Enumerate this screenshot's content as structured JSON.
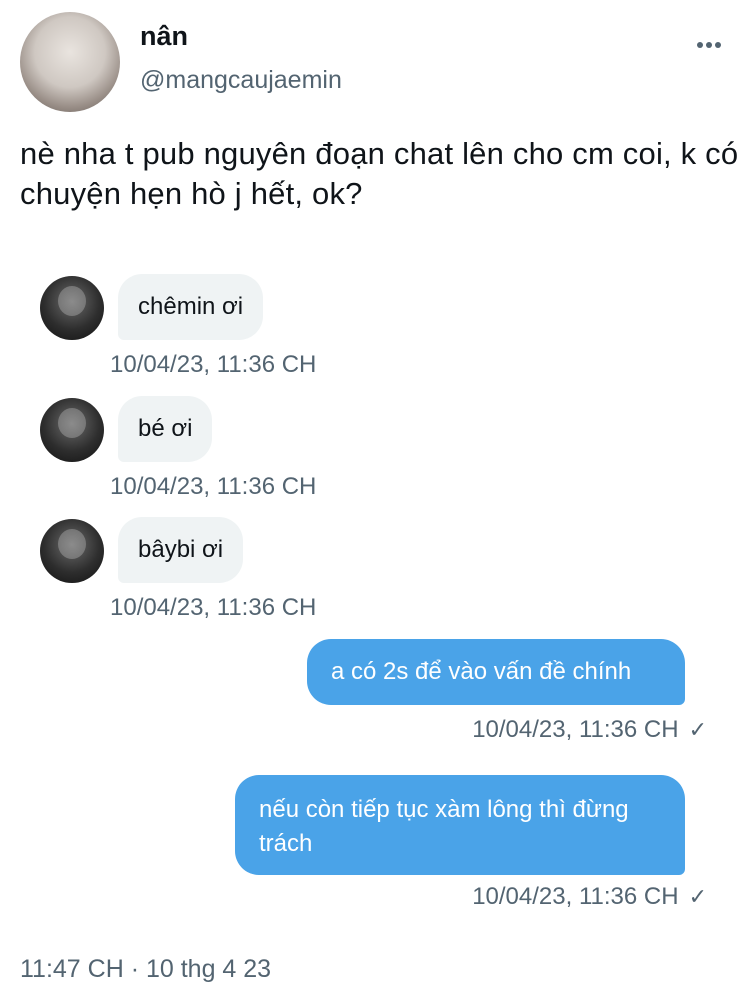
{
  "author": {
    "name": "nân",
    "handle": "@mangcaujaemin"
  },
  "tweet": {
    "text": "nè nha t pub nguyên đoạn chat lên cho cm coi, k có chuyện hẹn hò j hết, ok?"
  },
  "chat": {
    "messages": [
      {
        "direction": "in",
        "text": "chêmin ơi",
        "timestamp": "10/04/23, 11:36 CH"
      },
      {
        "direction": "in",
        "text": "bé ơi",
        "timestamp": "10/04/23, 11:36 CH"
      },
      {
        "direction": "in",
        "text": "bâybi ơi",
        "timestamp": "10/04/23, 11:36 CH"
      },
      {
        "direction": "out",
        "text": "a có 2s để vào vấn đề chính",
        "timestamp": "10/04/23, 11:36 CH",
        "check": "✓"
      },
      {
        "direction": "out",
        "text": "nếu còn tiếp tục xàm lông thì đừng trách",
        "timestamp": "10/04/23, 11:36 CH",
        "check": "✓"
      }
    ]
  },
  "footer": {
    "time": "11:47 CH · 10 thg 4 23"
  },
  "colors": {
    "bubble_out": "#4aa3e8",
    "bubble_in": "#eff3f4",
    "secondary_text": "#536471"
  },
  "icons": {
    "more": "more-horizontal-icon",
    "check": "check-icon"
  }
}
